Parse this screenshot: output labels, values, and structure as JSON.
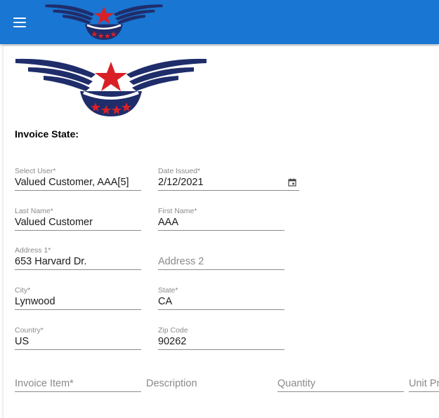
{
  "appbar": {
    "menu_icon": "menu-icon",
    "logo": "wings-star-logo"
  },
  "main_logo": "wings-star-logo",
  "colors": {
    "appbar": "#1976d2",
    "logo_navy": "#1f2d6b",
    "logo_red": "#d92027"
  },
  "form": {
    "section_title": "Invoice State:",
    "select_user": {
      "label": "Select User*",
      "value": "Valued Customer, AAA[5]"
    },
    "date_issued": {
      "label": "Date Issued*",
      "value": "2/12/2021",
      "icon": "calendar-icon"
    },
    "last_name": {
      "label": "Last Name*",
      "value": "Valued Customer"
    },
    "first_name": {
      "label": "First Name*",
      "value": "AAA"
    },
    "address1": {
      "label": "Address 1*",
      "value": "653 Harvard Dr."
    },
    "address2": {
      "placeholder": "Address 2"
    },
    "city": {
      "label": "City*",
      "value": "Lynwood"
    },
    "state": {
      "label": "State*",
      "value": "CA"
    },
    "country": {
      "label": "Country*",
      "value": "US"
    },
    "zip": {
      "label": "Zip Code",
      "value": "90262"
    }
  },
  "items": {
    "invoice_item": {
      "placeholder": "Invoice Item*"
    },
    "description": {
      "placeholder": "Description"
    },
    "quantity": {
      "placeholder": "Quantity"
    },
    "unit_price": {
      "placeholder": "Unit Price"
    }
  }
}
